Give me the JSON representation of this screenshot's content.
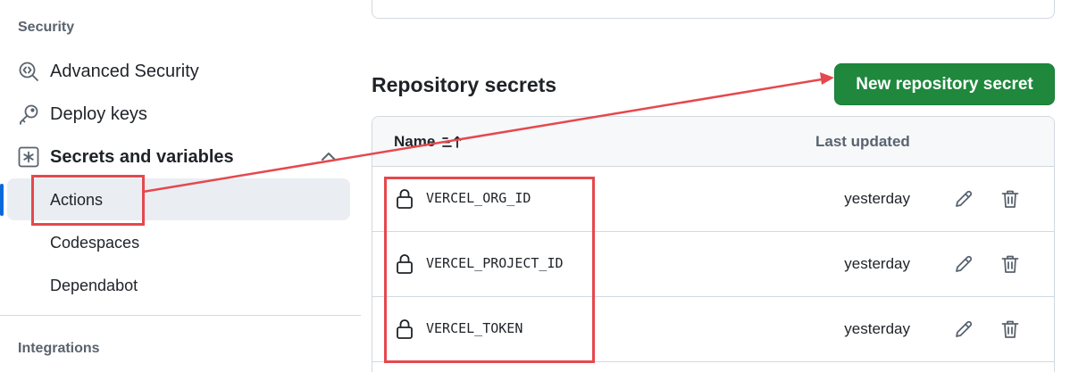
{
  "sidebar": {
    "security_heading": "Security",
    "items": [
      {
        "label": "Advanced Security",
        "icon": "codescan-icon"
      },
      {
        "label": "Deploy keys",
        "icon": "key-icon"
      },
      {
        "label": "Secrets and variables",
        "icon": "asterisk-icon",
        "expanded": true
      }
    ],
    "sub_items": [
      {
        "label": "Actions",
        "active": true
      },
      {
        "label": "Codespaces",
        "active": false
      },
      {
        "label": "Dependabot",
        "active": false
      }
    ],
    "integrations_heading": "Integrations"
  },
  "main": {
    "heading": "Repository secrets",
    "new_button_label": "New repository secret",
    "table": {
      "col_name": "Name",
      "col_updated": "Last updated",
      "rows": [
        {
          "name": "VERCEL_ORG_ID",
          "updated": "yesterday"
        },
        {
          "name": "VERCEL_PROJECT_ID",
          "updated": "yesterday"
        },
        {
          "name": "VERCEL_TOKEN",
          "updated": "yesterday"
        }
      ]
    }
  },
  "colors": {
    "primary_button": "#1f883d",
    "active_indicator": "#0969da",
    "annotation": "#e5484d"
  }
}
